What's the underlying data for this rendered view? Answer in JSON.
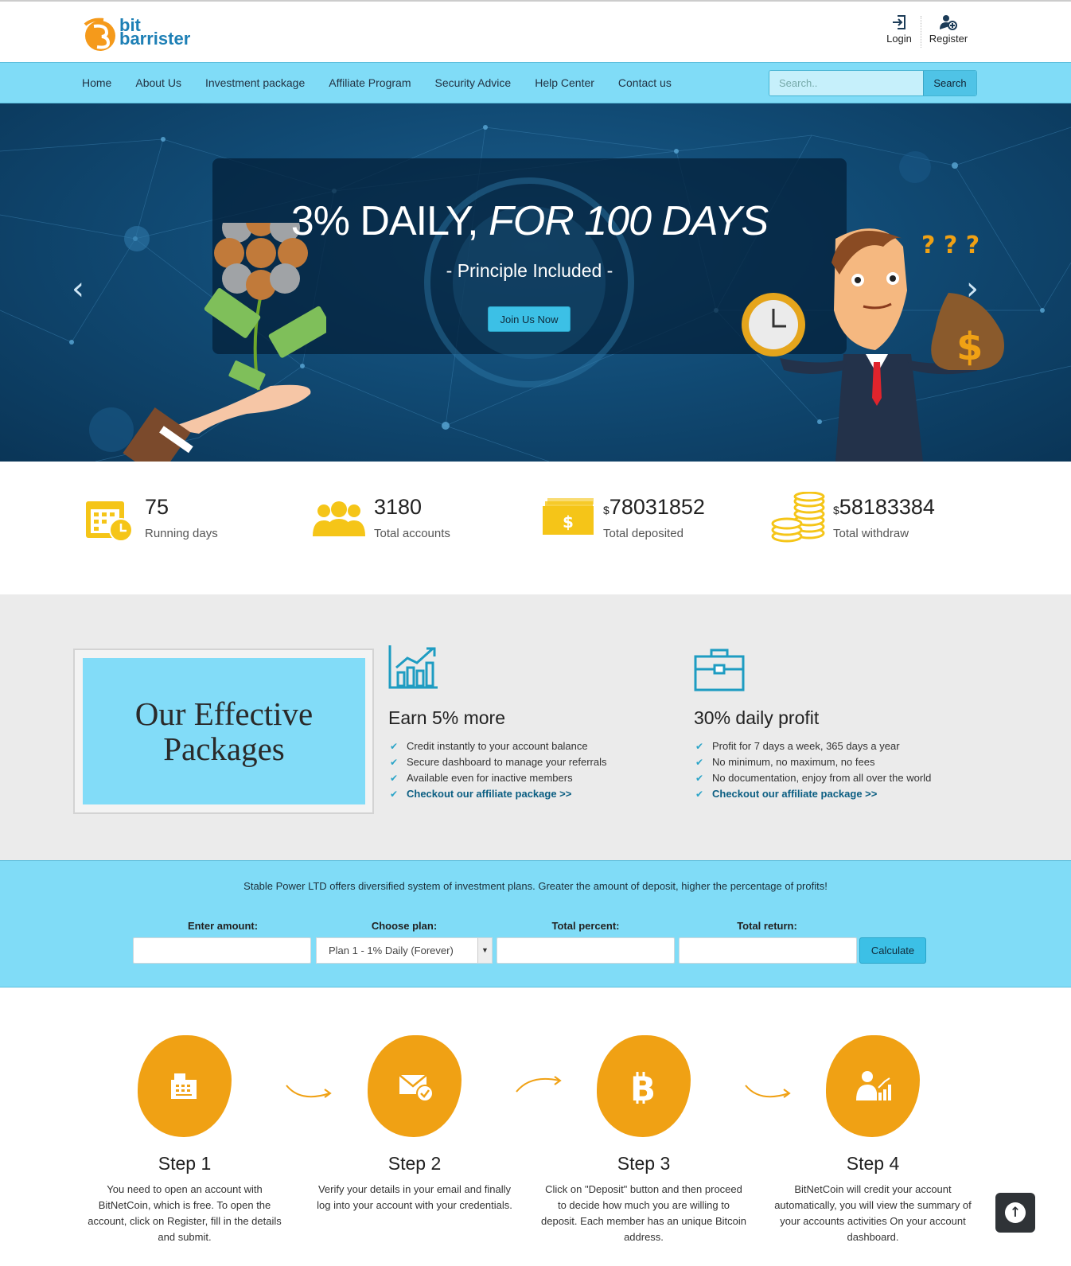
{
  "brand": {
    "line1": "bit",
    "line2": "barrister",
    "color": "#1d7fb5",
    "accent": "#f59a1b"
  },
  "header": {
    "login_label": "Login",
    "register_label": "Register"
  },
  "nav": {
    "items": [
      "Home",
      "About Us",
      "Investment package",
      "Affiliate Program",
      "Security Advice",
      "Help Center",
      "Contact us"
    ],
    "search_placeholder": "Search..",
    "search_button": "Search"
  },
  "hero": {
    "title_plain": "3% DAILY, ",
    "title_italic": "FOR 100 DAYS",
    "subtitle": "- Principle Included -",
    "cta": "Join Us Now",
    "prev_icon": "chevron-left-icon",
    "next_icon": "chevron-right-icon"
  },
  "stats": [
    {
      "value": "75",
      "currency": "",
      "label": "Running days",
      "icon": "calendar-clock-icon"
    },
    {
      "value": "3180",
      "currency": "",
      "label": "Total accounts",
      "icon": "users-icon"
    },
    {
      "value": "78031852",
      "currency": "$",
      "label": "Total deposited",
      "icon": "cash-icon"
    },
    {
      "value": "58183384",
      "currency": "$",
      "label": "Total withdraw",
      "icon": "coins-icon"
    }
  ],
  "packages": {
    "heading": "Our Effective Packages",
    "columns": [
      {
        "icon": "growth-chart-icon",
        "title": "Earn 5% more",
        "items": [
          "Credit instantly to your account balance",
          "Secure dashboard to manage your referrals",
          "Available even for inactive members"
        ],
        "link": "Checkout our affiliate package >>"
      },
      {
        "icon": "briefcase-icon",
        "title": "30% daily profit",
        "items": [
          "Profit for 7 days a week, 365 days a year",
          "No minimum, no maximum, no fees",
          "No documentation, enjoy from all over the world"
        ],
        "link": "Checkout our affiliate package >>"
      }
    ]
  },
  "calculator": {
    "intro": "Stable Power LTD offers diversified system of investment plans. Greater the amount of deposit, higher the percentage of profits!",
    "amount_label": "Enter amount:",
    "plan_label": "Choose plan:",
    "percent_label": "Total percent:",
    "return_label": "Total return:",
    "amount_value": "",
    "plan_selected": "Plan 1 - 1% Daily (Forever)",
    "percent_value": "",
    "return_value": "",
    "button": "Calculate"
  },
  "steps": [
    {
      "title": "Step 1",
      "text": "You need to open an account with BitNetCoin, which is free. To open the account, click on Register, fill in the details and submit.",
      "icon": "register-icon"
    },
    {
      "title": "Step 2",
      "text": "Verify your details in your email and finally log into your account with your credentials.",
      "icon": "email-verify-icon"
    },
    {
      "title": "Step 3",
      "text": "Click on \"Deposit\" button and then proceed to decide how much you are willing to deposit. Each member has an unique Bitcoin address.",
      "icon": "bitcoin-icon"
    },
    {
      "title": "Step 4",
      "text": "BitNetCoin will credit your account automatically, you will view the summary of your accounts activities On your account dashboard.",
      "icon": "dashboard-user-icon"
    }
  ],
  "colors": {
    "nav_bg": "#80dcf7",
    "button": "#3cc0e6",
    "step_orange": "#f0a114",
    "stat_yellow": "#f5c518"
  }
}
